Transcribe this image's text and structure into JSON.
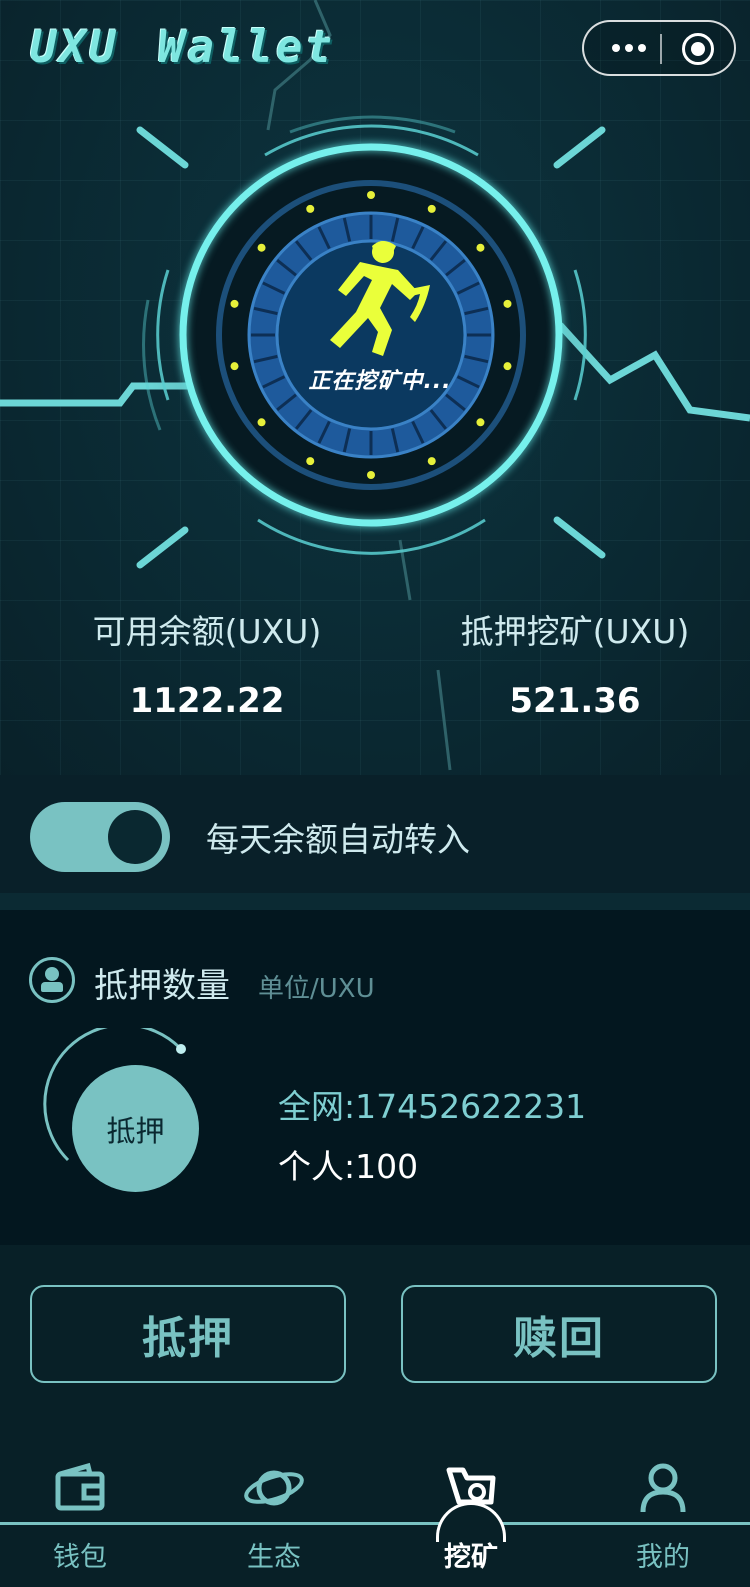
{
  "app": {
    "logo_text": "UXU Wallet"
  },
  "mining": {
    "status_text": "正在挖矿中..."
  },
  "balances": {
    "available": {
      "label": "可用余额(UXU)",
      "value": "1122.22"
    },
    "staked": {
      "label": "抵押挖矿(UXU)",
      "value": "521.36"
    }
  },
  "auto_transfer": {
    "label": "每天余额自动转入",
    "enabled": true
  },
  "stake": {
    "title": "抵押数量",
    "unit": "单位/UXU",
    "dial_button": "抵押",
    "network_total": "全网:17452622231",
    "personal": "个人:100"
  },
  "actions": {
    "stake": "抵押",
    "redeem": "赎回"
  },
  "tabs": [
    {
      "label": "钱包",
      "icon": "wallet-icon",
      "active": false
    },
    {
      "label": "生态",
      "icon": "planet-icon",
      "active": false
    },
    {
      "label": "挖矿",
      "icon": "mining-cart-icon",
      "active": true
    },
    {
      "label": "我的",
      "icon": "user-icon",
      "active": false
    }
  ],
  "colors": {
    "accent": "#79c2c2",
    "glow": "#5ee0e0",
    "background": "#0b2a33",
    "miner": "#eaff3a"
  }
}
